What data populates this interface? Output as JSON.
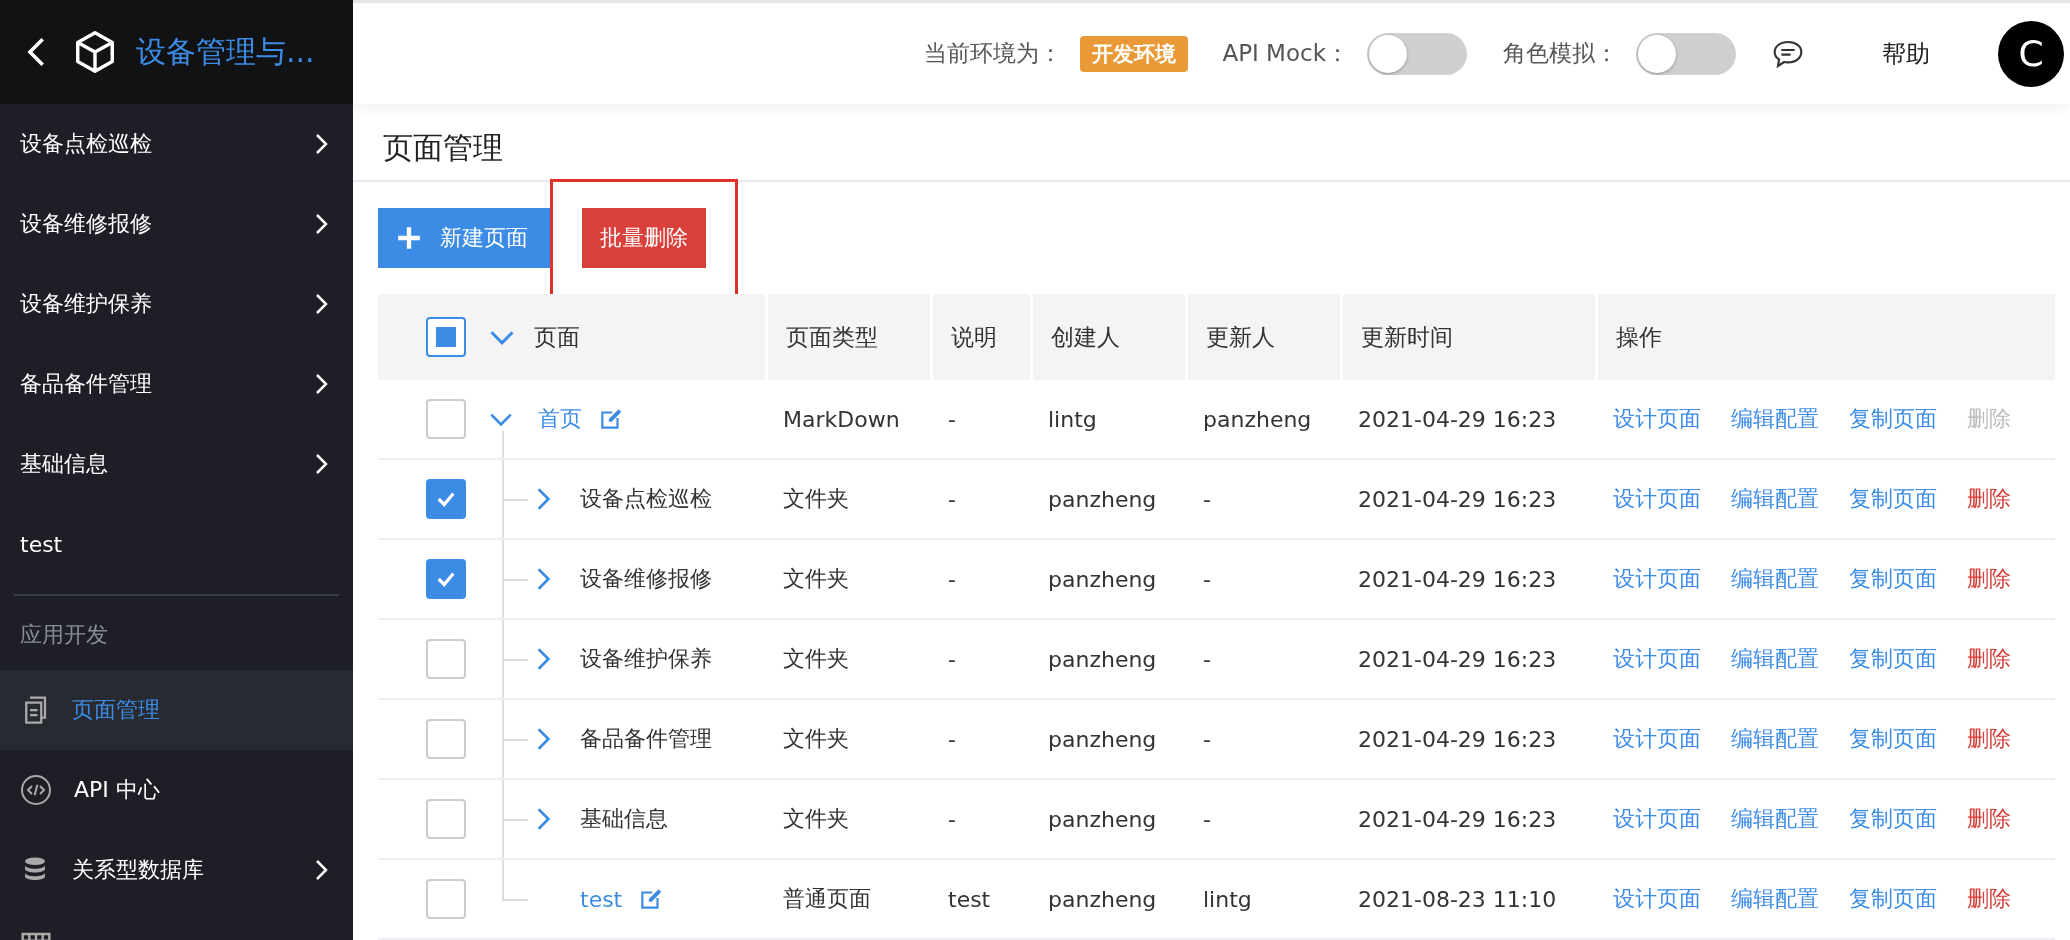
{
  "sidebar": {
    "title": "设备管理与...",
    "menu": [
      {
        "label": "设备点检巡检",
        "expandable": true
      },
      {
        "label": "设备维修报修",
        "expandable": true
      },
      {
        "label": "设备维护保养",
        "expandable": true
      },
      {
        "label": "备品备件管理",
        "expandable": true
      },
      {
        "label": "基础信息",
        "expandable": true
      },
      {
        "label": "test",
        "expandable": false
      }
    ],
    "section": "应用开发",
    "dev_menu": [
      {
        "label": "页面管理",
        "expandable": false,
        "selected": true
      },
      {
        "label": "API 中心",
        "expandable": false,
        "selected": false
      },
      {
        "label": "关系型数据库",
        "expandable": true,
        "selected": false
      }
    ]
  },
  "header": {
    "env_label": "当前环境为：",
    "env_badge": "开发环境",
    "toggles": [
      {
        "label": "API Mock：",
        "on": false
      },
      {
        "label": "角色模拟：",
        "on": false
      }
    ],
    "help": "帮助",
    "avatar": "C"
  },
  "page": {
    "title": "页面管理",
    "new_button": "新建页面",
    "bulk_delete_button": "批量删除"
  },
  "table": {
    "select_all": {
      "checked": false,
      "indeterminate": true
    },
    "columns": [
      "页面",
      "页面类型",
      "说明",
      "创建人",
      "更新人",
      "更新时间",
      "操作"
    ],
    "rows": [
      {
        "name": "首页",
        "kind": "page",
        "type": "MarkDown",
        "description": "-",
        "creator": "lintg",
        "updater": "panzheng",
        "updated": "2021-04-29 16:23",
        "checked": false,
        "expanded": true,
        "actions": [
          {
            "label": "设计页面",
            "kind": "link",
            "disabled": false
          },
          {
            "label": "编辑配置",
            "kind": "link",
            "disabled": false
          },
          {
            "label": "复制页面",
            "kind": "link",
            "disabled": false
          },
          {
            "label": "删除",
            "kind": "delete",
            "disabled": true
          }
        ],
        "children": [
          {
            "name": "设备点检巡检",
            "kind": "folder",
            "type": "文件夹",
            "description": "-",
            "creator": "panzheng",
            "updater": "-",
            "updated": "2021-04-29 16:23",
            "checked": true,
            "expanded": false,
            "actions": [
              {
                "label": "设计页面",
                "kind": "link",
                "disabled": false
              },
              {
                "label": "编辑配置",
                "kind": "link",
                "disabled": false
              },
              {
                "label": "复制页面",
                "kind": "link",
                "disabled": false
              },
              {
                "label": "删除",
                "kind": "delete",
                "disabled": false
              }
            ]
          },
          {
            "name": "设备维修报修",
            "kind": "folder",
            "type": "文件夹",
            "description": "-",
            "creator": "panzheng",
            "updater": "-",
            "updated": "2021-04-29 16:23",
            "checked": true,
            "expanded": false,
            "actions": [
              {
                "label": "设计页面",
                "kind": "link",
                "disabled": false
              },
              {
                "label": "编辑配置",
                "kind": "link",
                "disabled": false
              },
              {
                "label": "复制页面",
                "kind": "link",
                "disabled": false
              },
              {
                "label": "删除",
                "kind": "delete",
                "disabled": false
              }
            ]
          },
          {
            "name": "设备维护保养",
            "kind": "folder",
            "type": "文件夹",
            "description": "-",
            "creator": "panzheng",
            "updater": "-",
            "updated": "2021-04-29 16:23",
            "checked": false,
            "expanded": false,
            "actions": [
              {
                "label": "设计页面",
                "kind": "link",
                "disabled": false
              },
              {
                "label": "编辑配置",
                "kind": "link",
                "disabled": false
              },
              {
                "label": "复制页面",
                "kind": "link",
                "disabled": false
              },
              {
                "label": "删除",
                "kind": "delete",
                "disabled": false
              }
            ]
          },
          {
            "name": "备品备件管理",
            "kind": "folder",
            "type": "文件夹",
            "description": "-",
            "creator": "panzheng",
            "updater": "-",
            "updated": "2021-04-29 16:23",
            "checked": false,
            "expanded": false,
            "actions": [
              {
                "label": "设计页面",
                "kind": "link",
                "disabled": false
              },
              {
                "label": "编辑配置",
                "kind": "link",
                "disabled": false
              },
              {
                "label": "复制页面",
                "kind": "link",
                "disabled": false
              },
              {
                "label": "删除",
                "kind": "delete",
                "disabled": false
              }
            ]
          },
          {
            "name": "基础信息",
            "kind": "folder",
            "type": "文件夹",
            "description": "-",
            "creator": "panzheng",
            "updater": "-",
            "updated": "2021-04-29 16:23",
            "checked": false,
            "expanded": false,
            "actions": [
              {
                "label": "设计页面",
                "kind": "link",
                "disabled": false
              },
              {
                "label": "编辑配置",
                "kind": "link",
                "disabled": false
              },
              {
                "label": "复制页面",
                "kind": "link",
                "disabled": false
              },
              {
                "label": "删除",
                "kind": "delete",
                "disabled": false
              }
            ]
          },
          {
            "name": "test",
            "kind": "page",
            "type": "普通页面",
            "description": "test",
            "creator": "panzheng",
            "updater": "lintg",
            "updated": "2021-08-23 11:10",
            "checked": false,
            "actions": [
              {
                "label": "设计页面",
                "kind": "link",
                "disabled": false
              },
              {
                "label": "编辑配置",
                "kind": "link",
                "disabled": false
              },
              {
                "label": "复制页面",
                "kind": "link",
                "disabled": false
              },
              {
                "label": "删除",
                "kind": "delete",
                "disabled": false
              }
            ]
          }
        ]
      }
    ]
  }
}
